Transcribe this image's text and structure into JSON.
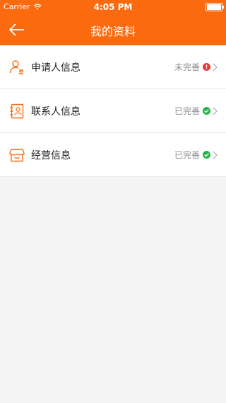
{
  "status_bar": {
    "carrier": "Carrier",
    "time": "4:05 PM"
  },
  "header": {
    "title": "我的资料"
  },
  "items": [
    {
      "label": "申请人信息",
      "status": "未完善",
      "icon": "user-list-icon",
      "state": "incomplete"
    },
    {
      "label": "联系人信息",
      "status": "已完善",
      "icon": "contact-book-icon",
      "state": "complete"
    },
    {
      "label": "经营信息",
      "status": "已完善",
      "icon": "store-icon",
      "state": "complete"
    }
  ],
  "colors": {
    "accent": "#fb6a0f",
    "error": "#e63a3a",
    "success": "#29b14a"
  }
}
